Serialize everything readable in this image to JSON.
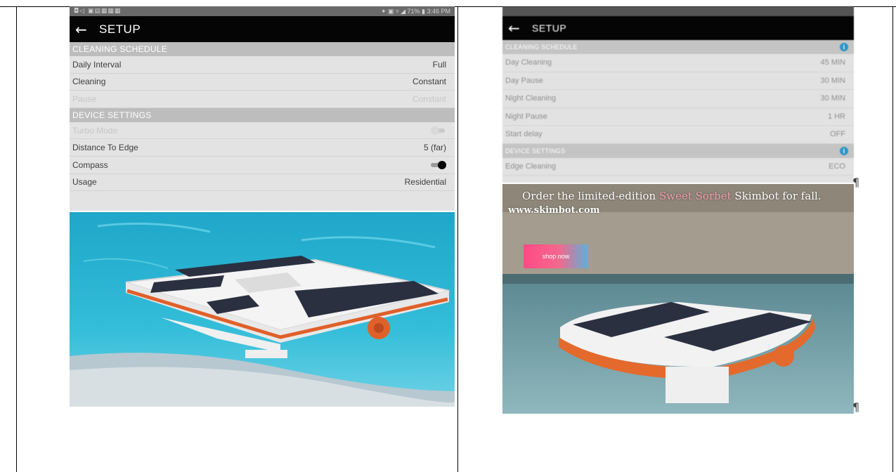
{
  "left_screenshot": {
    "status_bar": {
      "left_icons": "◘◁ ▣▤▦▦▦",
      "right_text": "✦ ▣ ▿ ◢ 71% ▮ 3:46 PM"
    },
    "app_bar": {
      "back_glyph": "←",
      "title": "SETUP"
    },
    "sections": [
      {
        "title": "CLEANING SCHEDULE",
        "rows": [
          {
            "label": "Daily Interval",
            "value": "Full"
          },
          {
            "label": "Cleaning",
            "value": "Constant"
          },
          {
            "label": "Pause",
            "value": "Constant"
          }
        ]
      },
      {
        "title": "DEVICE SETTINGS",
        "rows": [
          {
            "label": "Turbo Mode",
            "value": ""
          },
          {
            "label": "Distance To Edge",
            "value": "5 (far)"
          },
          {
            "label": "Compass",
            "value": ""
          },
          {
            "label": "Usage",
            "value": "Residential"
          }
        ]
      }
    ]
  },
  "right_screenshot": {
    "app_bar": {
      "back_glyph": "←",
      "title": "SETUP"
    },
    "sections": [
      {
        "title": "CLEANING SCHEDULE",
        "rows": [
          {
            "label": "Day Cleaning",
            "value": "45 MIN"
          },
          {
            "label": "Day Pause",
            "value": "30 MIN"
          },
          {
            "label": "Night Cleaning",
            "value": "30 MIN"
          },
          {
            "label": "Night Pause",
            "value": "1 HR"
          },
          {
            "label": "Start delay",
            "value": "OFF"
          }
        ]
      },
      {
        "title": "DEVICE SETTINGS",
        "rows": [
          {
            "label": "Edge Cleaning",
            "value": "ECO"
          }
        ]
      }
    ],
    "info_icon_glyph": "i"
  },
  "ad": {
    "headline_pre": "Order the limited-edition",
    "headline_highlight": "Sweet Sorbet",
    "headline_post": "Skimbot for fall.",
    "url": "www.skimbot.com",
    "button_label": "shop now"
  },
  "pilcrow": "¶",
  "colors": {
    "app_bar": "#050505",
    "section_header": "#bdbdbd",
    "row_bg": "#e3e3e3",
    "info_icon": "#2e95c8",
    "pool_water": "#29b5d4",
    "robot_hull": "#f4f4f4",
    "robot_trim": "#e0602a",
    "solar_panel": "#2a3040",
    "ad_button": "#ff4a86"
  }
}
